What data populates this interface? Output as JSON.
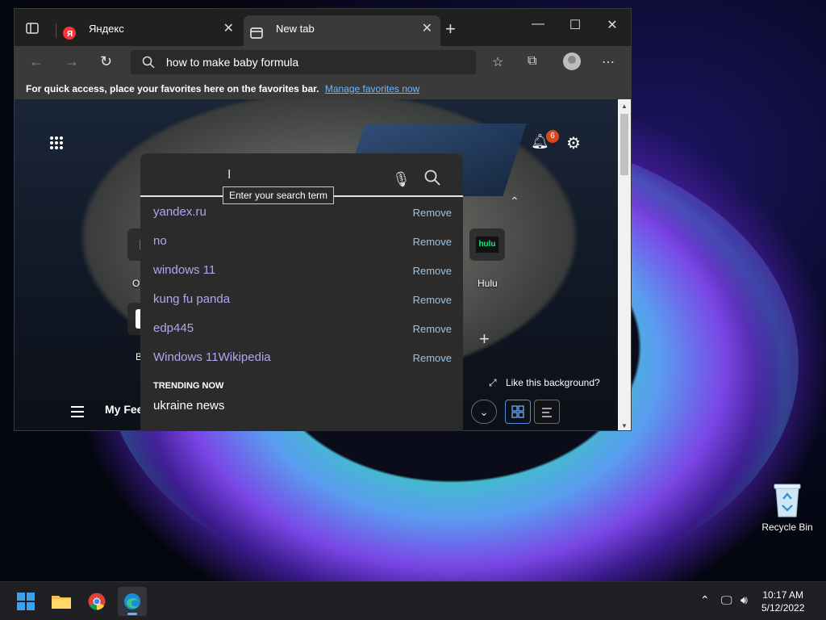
{
  "desktop": {
    "recycle_bin_label": "Recycle Bin"
  },
  "browser": {
    "tabs": [
      {
        "label": "Яндекс",
        "icon": "yandex-icon"
      },
      {
        "label": "New tab",
        "icon": "newtab-icon"
      }
    ],
    "address": "how to make baby formula",
    "favorites_bar": {
      "message": "For quick access, place your favorites here on the favorites bar.",
      "link": "Manage favorites now"
    },
    "notifications_count": "6",
    "search": {
      "tooltip": "Enter your search term",
      "history": [
        {
          "text": "yandex.ru",
          "action": "Remove"
        },
        {
          "text": "no",
          "action": "Remove"
        },
        {
          "text": "windows 11",
          "action": "Remove"
        },
        {
          "text": "kung fu panda",
          "action": "Remove"
        },
        {
          "text": "edp445",
          "action": "Remove"
        },
        {
          "text": "Windows 11Wikipedia",
          "action": "Remove"
        }
      ],
      "trending_header": "TRENDING NOW",
      "trending": [
        "ukraine news"
      ]
    },
    "tiles": [
      {
        "label": "Office"
      },
      {
        "label": "Bing"
      },
      {
        "label": "Hulu"
      }
    ],
    "like_background": "Like this background?",
    "my_feed": "My Feed"
  },
  "taskbar": {
    "time": "10:17 AM",
    "date": "5/12/2022"
  },
  "colors": {
    "accent": "#6bb6ff",
    "history_text": "#b7a3ef",
    "remove_text": "#9bc0e0",
    "badge": "#d9471f"
  }
}
